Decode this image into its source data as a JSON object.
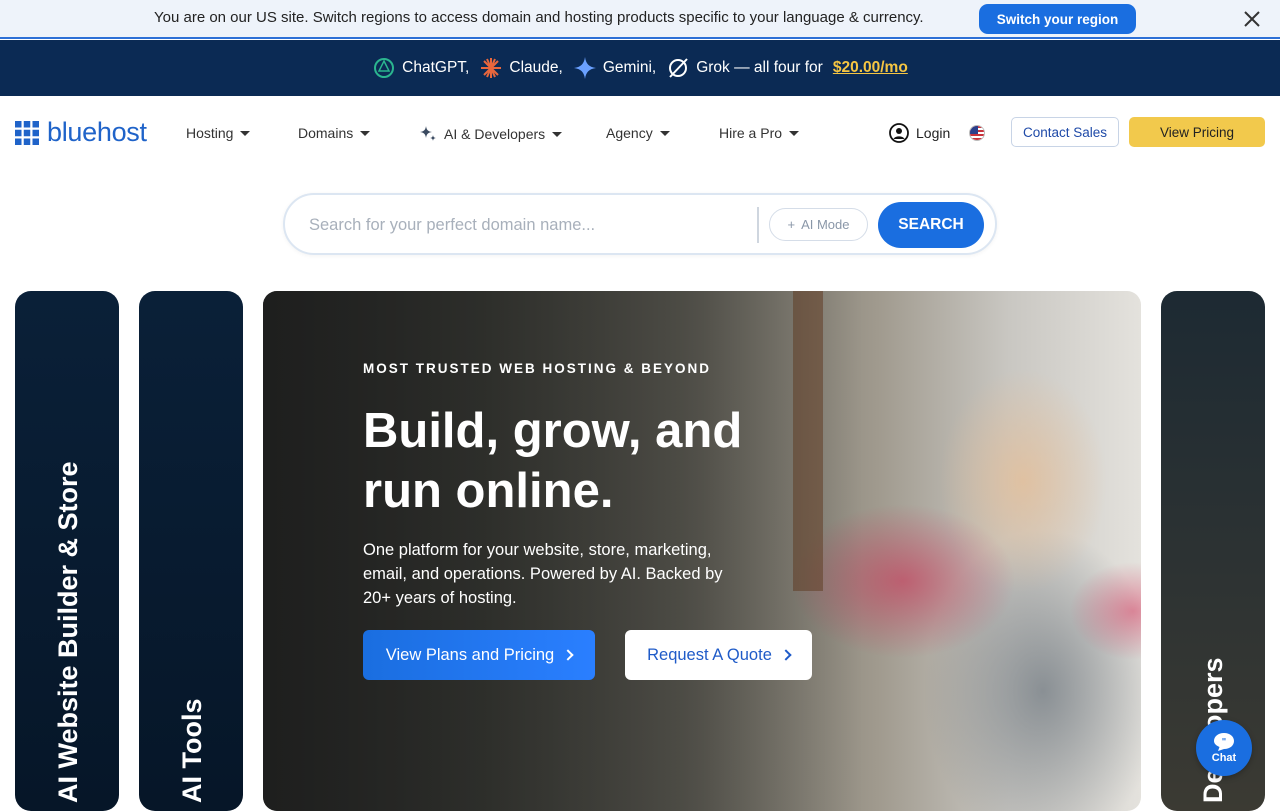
{
  "region_bar": {
    "message": "You are on our US site. Switch regions to access domain and hosting products specific to your language & currency.",
    "switch_label": "Switch your region",
    "close_icon": "close-icon"
  },
  "promo": {
    "items": [
      {
        "label": "ChatGPT,",
        "icon": "chatgpt-icon"
      },
      {
        "label": "Claude,",
        "icon": "claude-icon"
      },
      {
        "label": "Gemini,",
        "icon": "gemini-icon"
      },
      {
        "label": "Grok — all four for",
        "icon": "grok-icon"
      }
    ],
    "price": "$20.00/mo",
    "colors": {
      "background": "#0b2a54",
      "price": "#f5c542"
    }
  },
  "nav": {
    "logo": "bluehost",
    "menu": [
      "Hosting",
      "Domains",
      "AI & Developers",
      "Agency",
      "Hire a Pro"
    ],
    "login": "Login",
    "contact_sales": "Contact Sales",
    "view_pricing": "View Pricing",
    "flag_icon": "us-flag-icon"
  },
  "search": {
    "placeholder": "Search for your perfect domain name...",
    "ai_mode": "AI Mode",
    "button": "SEARCH"
  },
  "cards": {
    "left1": "AI Website Builder & Store",
    "left2": "AI Tools",
    "right": "Developers"
  },
  "hero": {
    "eyebrow": "MOST TRUSTED WEB HOSTING & BEYOND",
    "title": "Build, grow, and run online.",
    "subtitle": "One platform for your website, store, marketing, email, and operations. Powered by AI. Backed by 20+ years of hosting.",
    "primary_cta": "View Plans and Pricing",
    "secondary_cta": "Request A Quote"
  },
  "chat": {
    "label": "Chat"
  },
  "colors": {
    "accent": "#1a6ee0",
    "pricing_button": "#f2c94c",
    "card_dark": "#0b1e33"
  }
}
